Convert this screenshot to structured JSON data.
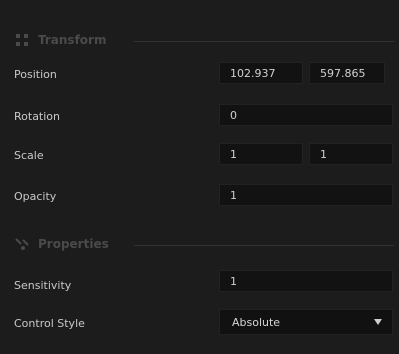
{
  "sections": {
    "transform": {
      "title": "Transform",
      "icon": "move-icon"
    },
    "properties": {
      "title": "Properties",
      "icon": "tools-icon"
    }
  },
  "rows": {
    "position": {
      "label": "Position",
      "x": "102.937",
      "y": "597.865"
    },
    "rotation": {
      "label": "Rotation",
      "value": "0"
    },
    "scale": {
      "label": "Scale",
      "x": "1",
      "y": "1"
    },
    "opacity": {
      "label": "Opacity",
      "value": "1"
    },
    "sensitivity": {
      "label": "Sensitivity",
      "value": "1"
    },
    "control_style": {
      "label": "Control Style",
      "selected": "Absolute"
    }
  }
}
